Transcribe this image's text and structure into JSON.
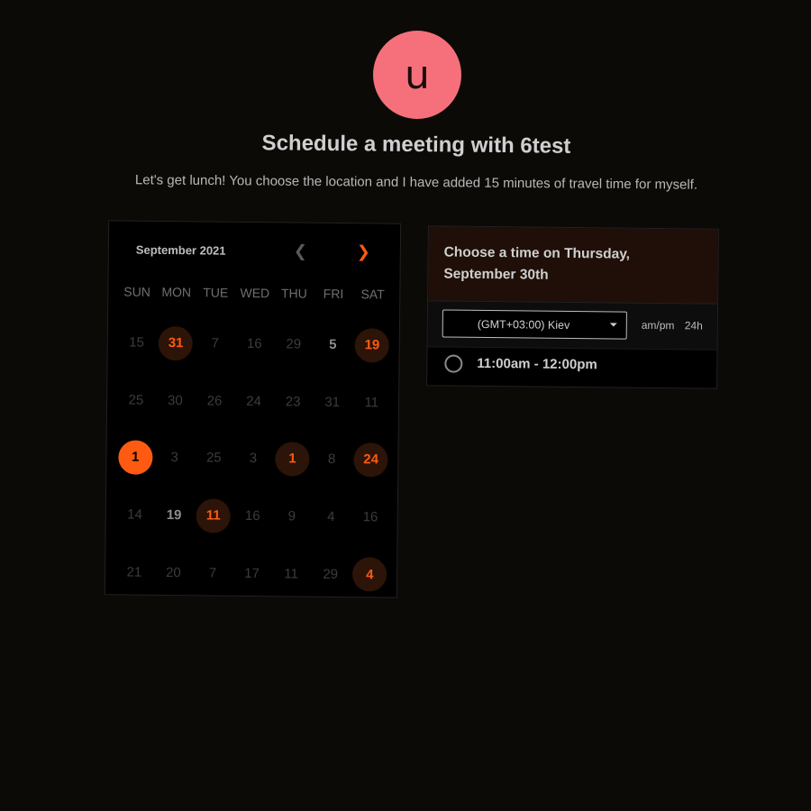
{
  "avatar": {
    "initial": "u",
    "color": "#f5707a"
  },
  "title": "Schedule a meeting with 6test",
  "subtitle": "Let's get lunch! You choose the location and I have added 15 minutes of travel time for myself.",
  "calendar": {
    "month_label": "September 2021",
    "prev_icon": "chevron-left-icon",
    "next_icon": "chevron-right-icon",
    "weekdays": [
      "SUN",
      "MON",
      "TUE",
      "WED",
      "THU",
      "FRI",
      "SAT"
    ],
    "days": [
      {
        "label": "15",
        "state": "dim"
      },
      {
        "label": "31",
        "state": "available"
      },
      {
        "label": "7",
        "state": "dim"
      },
      {
        "label": "16",
        "state": "dim"
      },
      {
        "label": "29",
        "state": "dim"
      },
      {
        "label": "5",
        "state": "light"
      },
      {
        "label": "19",
        "state": "available"
      },
      {
        "label": "25",
        "state": "dim"
      },
      {
        "label": "30",
        "state": "dim"
      },
      {
        "label": "26",
        "state": "dim"
      },
      {
        "label": "24",
        "state": "dim"
      },
      {
        "label": "23",
        "state": "dim"
      },
      {
        "label": "31",
        "state": "dim"
      },
      {
        "label": "11",
        "state": "dim"
      },
      {
        "label": "1",
        "state": "selected"
      },
      {
        "label": "3",
        "state": "dim"
      },
      {
        "label": "25",
        "state": "dim"
      },
      {
        "label": "3",
        "state": "dim"
      },
      {
        "label": "1",
        "state": "available"
      },
      {
        "label": "8",
        "state": "dim"
      },
      {
        "label": "24",
        "state": "available"
      },
      {
        "label": "14",
        "state": "dim"
      },
      {
        "label": "19",
        "state": "light"
      },
      {
        "label": "11",
        "state": "available"
      },
      {
        "label": "16",
        "state": "dim"
      },
      {
        "label": "9",
        "state": "dim"
      },
      {
        "label": "4",
        "state": "dim"
      },
      {
        "label": "16",
        "state": "dim"
      },
      {
        "label": "21",
        "state": "dim"
      },
      {
        "label": "20",
        "state": "dim"
      },
      {
        "label": "7",
        "state": "dim"
      },
      {
        "label": "17",
        "state": "dim"
      },
      {
        "label": "11",
        "state": "dim"
      },
      {
        "label": "29",
        "state": "dim"
      },
      {
        "label": "4",
        "state": "available"
      }
    ]
  },
  "time_panel": {
    "header": "Choose a time on Thursday, September 30th",
    "timezone": "(GMT+03:00) Kiev",
    "format_ampm": "am/pm",
    "format_24h": "24h",
    "slots": [
      {
        "label": "11:00am - 12:00pm",
        "selected": false
      }
    ]
  },
  "colors": {
    "accent": "#ff5a12",
    "background": "#0c0a07",
    "available_bg": "#2c1408"
  }
}
